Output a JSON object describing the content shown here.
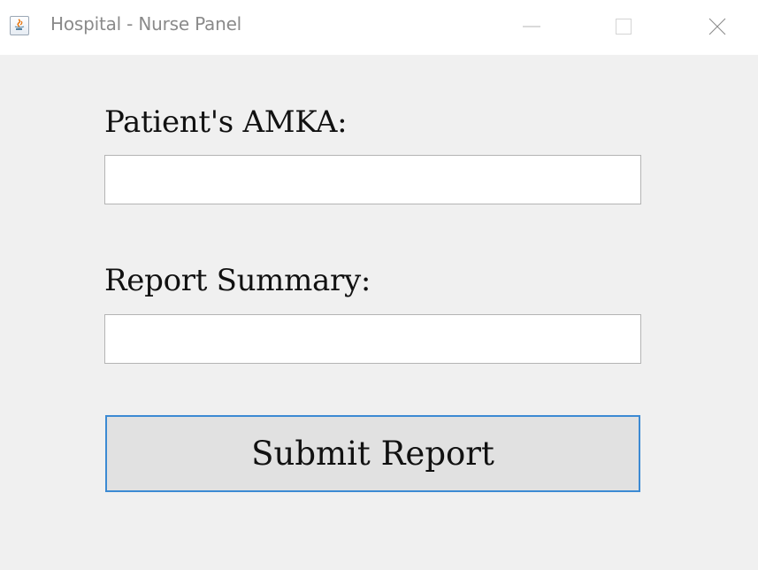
{
  "window": {
    "title": "Hospital - Nurse Panel",
    "app_icon": "java-icon"
  },
  "controls": {
    "minimize_icon": "minimize-icon",
    "maximize_icon": "maximize-icon",
    "close_icon": "close-icon"
  },
  "form": {
    "amka_label": "Patient's AMKA:",
    "amka_value": "",
    "summary_label": "Report Summary:",
    "summary_value": "",
    "submit_label": "Submit Report"
  },
  "colors": {
    "background": "#f0f0f0",
    "focus_border": "#3c8ad3",
    "button_face": "#e1e1e1"
  }
}
